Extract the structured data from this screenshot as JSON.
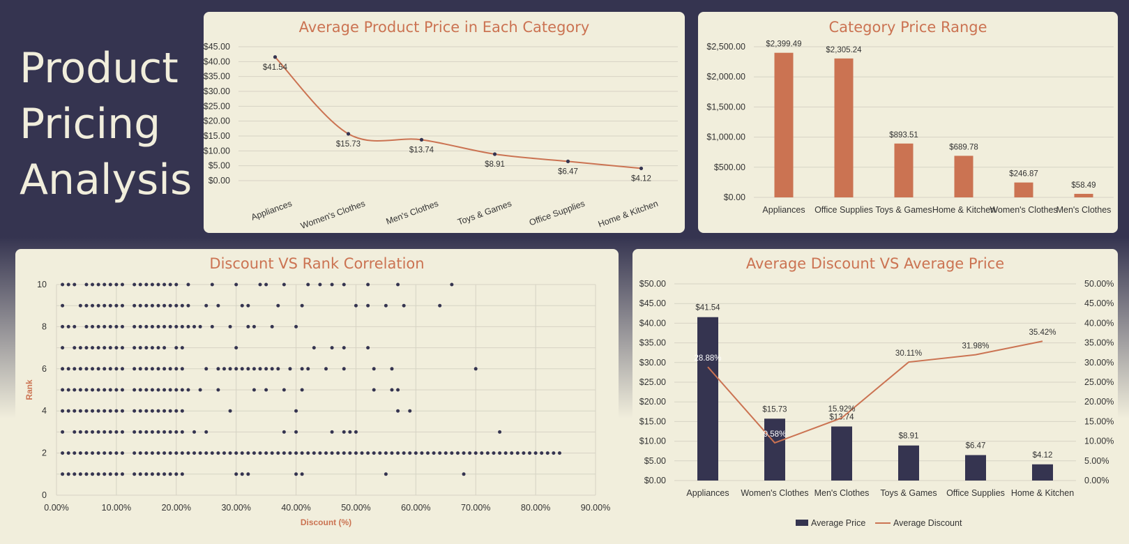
{
  "page": {
    "title_lines": [
      "Product",
      "Pricing",
      "Analysis"
    ],
    "colors": {
      "navy": "#353450",
      "cream": "#f1eedc",
      "accent": "#cb7352",
      "grid": "#d6d3c4",
      "text": "#333333"
    }
  },
  "chart_data": [
    {
      "id": "avg-price",
      "type": "line",
      "title": "Average Product Price in Each Category",
      "categories": [
        "Appliances",
        "Women's Clothes",
        "Men's Clothes",
        "Toys & Games",
        "Office Supplies",
        "Home & Kitchen"
      ],
      "values": [
        41.54,
        15.73,
        13.74,
        8.91,
        6.47,
        4.12
      ],
      "data_labels": [
        "$41.54",
        "$15.73",
        "$13.74",
        "$8.91",
        "$6.47",
        "$4.12"
      ],
      "yticks": [
        "$0.00",
        "$5.00",
        "$10.00",
        "$15.00",
        "$20.00",
        "$25.00",
        "$30.00",
        "$35.00",
        "$40.00",
        "$45.00"
      ],
      "ylim": [
        0,
        45
      ],
      "smooth": true,
      "grid": true
    },
    {
      "id": "price-range",
      "type": "bar",
      "title": "Category Price Range",
      "categories": [
        "Appliances",
        "Office Supplies",
        "Toys & Games",
        "Home & Kitchen",
        "Women's Clothes",
        "Men's Clothes"
      ],
      "values": [
        2399.49,
        2305.24,
        893.51,
        689.78,
        246.87,
        58.49
      ],
      "data_labels": [
        "$2,399.49",
        "$2,305.24",
        "$893.51",
        "$689.78",
        "$246.87",
        "$58.49"
      ],
      "yticks": [
        "$0.00",
        "$500.00",
        "$1,000.00",
        "$1,500.00",
        "$2,000.00",
        "$2,500.00"
      ],
      "ylim": [
        0,
        2500
      ],
      "grid": true
    },
    {
      "id": "discount-rank",
      "type": "scatter",
      "title": "Discount VS Rank Correlation",
      "xlabel": "Discount (%)",
      "ylabel": "Rank",
      "xlim": [
        0,
        90
      ],
      "ylim": [
        0,
        10
      ],
      "xticks": [
        "0.00%",
        "10.00%",
        "20.00%",
        "30.00%",
        "40.00%",
        "50.00%",
        "60.00%",
        "70.00%",
        "80.00%",
        "90.00%"
      ],
      "yticks": [
        "0",
        "2",
        "4",
        "6",
        "8",
        "10"
      ],
      "points_by_rank": {
        "10": [
          1,
          2,
          3,
          5,
          6,
          7,
          8,
          9,
          10,
          11,
          13,
          14,
          15,
          16,
          17,
          18,
          19,
          20,
          22,
          26,
          30,
          34,
          35,
          38,
          42,
          44,
          46,
          48,
          52,
          57,
          66
        ],
        "9": [
          1,
          4,
          5,
          6,
          7,
          8,
          9,
          10,
          11,
          13,
          14,
          15,
          16,
          17,
          18,
          19,
          20,
          21,
          22,
          25,
          27,
          31,
          32,
          37,
          41,
          50,
          52,
          55,
          58,
          64
        ],
        "8": [
          1,
          2,
          3,
          5,
          6,
          7,
          8,
          9,
          10,
          11,
          13,
          14,
          15,
          16,
          17,
          18,
          19,
          20,
          21,
          22,
          23,
          24,
          26,
          29,
          32,
          33,
          36,
          40
        ],
        "7": [
          1,
          3,
          4,
          5,
          6,
          7,
          8,
          9,
          10,
          11,
          13,
          14,
          15,
          16,
          17,
          18,
          20,
          21,
          30,
          43,
          46,
          48,
          52
        ],
        "6": [
          1,
          2,
          3,
          4,
          5,
          6,
          7,
          8,
          9,
          10,
          11,
          13,
          14,
          15,
          16,
          17,
          18,
          19,
          20,
          21,
          25,
          27,
          28,
          29,
          30,
          31,
          32,
          33,
          34,
          35,
          36,
          37,
          39,
          41,
          42,
          45,
          48,
          53,
          56,
          70
        ],
        "5": [
          1,
          2,
          3,
          4,
          5,
          6,
          7,
          8,
          9,
          10,
          11,
          13,
          14,
          15,
          16,
          17,
          18,
          19,
          20,
          21,
          22,
          24,
          27,
          33,
          35,
          38,
          41,
          53,
          56,
          57
        ],
        "4": [
          1,
          2,
          3,
          4,
          5,
          6,
          7,
          8,
          9,
          10,
          11,
          13,
          14,
          15,
          16,
          17,
          18,
          19,
          20,
          21,
          29,
          40,
          57,
          59
        ],
        "3": [
          1,
          3,
          4,
          5,
          6,
          7,
          8,
          9,
          10,
          11,
          13,
          14,
          15,
          16,
          17,
          18,
          19,
          20,
          21,
          23,
          25,
          38,
          40,
          46,
          48,
          49,
          50,
          74
        ],
        "2": [
          1,
          2,
          3,
          4,
          5,
          6,
          7,
          8,
          9,
          10,
          11,
          13,
          14,
          15,
          16,
          17,
          18,
          19,
          20,
          21,
          22,
          23,
          24,
          25,
          26,
          27,
          28,
          29,
          30,
          31,
          32,
          33,
          34,
          35,
          36,
          37,
          38,
          39,
          40,
          41,
          42,
          43,
          44,
          45,
          46,
          47,
          48,
          49,
          50,
          51,
          52,
          53,
          54,
          55,
          56,
          57,
          58,
          59,
          60,
          61,
          62,
          63,
          64,
          65,
          66,
          67,
          68,
          69,
          70,
          71,
          72,
          73,
          74,
          75,
          76,
          77,
          78,
          79,
          80,
          81,
          82,
          83,
          84
        ],
        "1": [
          1,
          2,
          3,
          4,
          5,
          6,
          7,
          8,
          9,
          10,
          11,
          13,
          14,
          15,
          16,
          17,
          18,
          19,
          20,
          21,
          30,
          31,
          32,
          40,
          41,
          55,
          68
        ]
      },
      "grid": true
    },
    {
      "id": "discount-vs-price",
      "type": "bar",
      "title": "Average Discount VS Average Price",
      "categories": [
        "Appliances",
        "Women's Clothes",
        "Men's Clothes",
        "Toys & Games",
        "Office Supplies",
        "Home & Kitchen"
      ],
      "series": [
        {
          "name": "Average Price",
          "type": "bar",
          "axis": "left",
          "values": [
            41.54,
            15.73,
            13.74,
            8.91,
            6.47,
            4.12
          ],
          "data_labels": [
            "$41.54",
            "$15.73",
            "$13.74",
            "$8.91",
            "$6.47",
            "$4.12"
          ]
        },
        {
          "name": "Average Discount",
          "type": "line",
          "axis": "right",
          "values": [
            28.88,
            9.58,
            15.92,
            30.11,
            31.98,
            35.42
          ],
          "data_labels": [
            "28.88%",
            "9.58%",
            "15.92%",
            "30.11%",
            "31.98%",
            "35.42%"
          ]
        }
      ],
      "yticks_left": [
        "$0.00",
        "$5.00",
        "$10.00",
        "$15.00",
        "$20.00",
        "$25.00",
        "$30.00",
        "$35.00",
        "$40.00",
        "$45.00",
        "$50.00"
      ],
      "yticks_right": [
        "0.00%",
        "5.00%",
        "10.00%",
        "15.00%",
        "20.00%",
        "25.00%",
        "30.00%",
        "35.00%",
        "40.00%",
        "45.00%",
        "50.00%"
      ],
      "ylim_left": [
        0,
        50
      ],
      "ylim_right": [
        0,
        50
      ],
      "legend": "bottom",
      "grid": true
    }
  ]
}
